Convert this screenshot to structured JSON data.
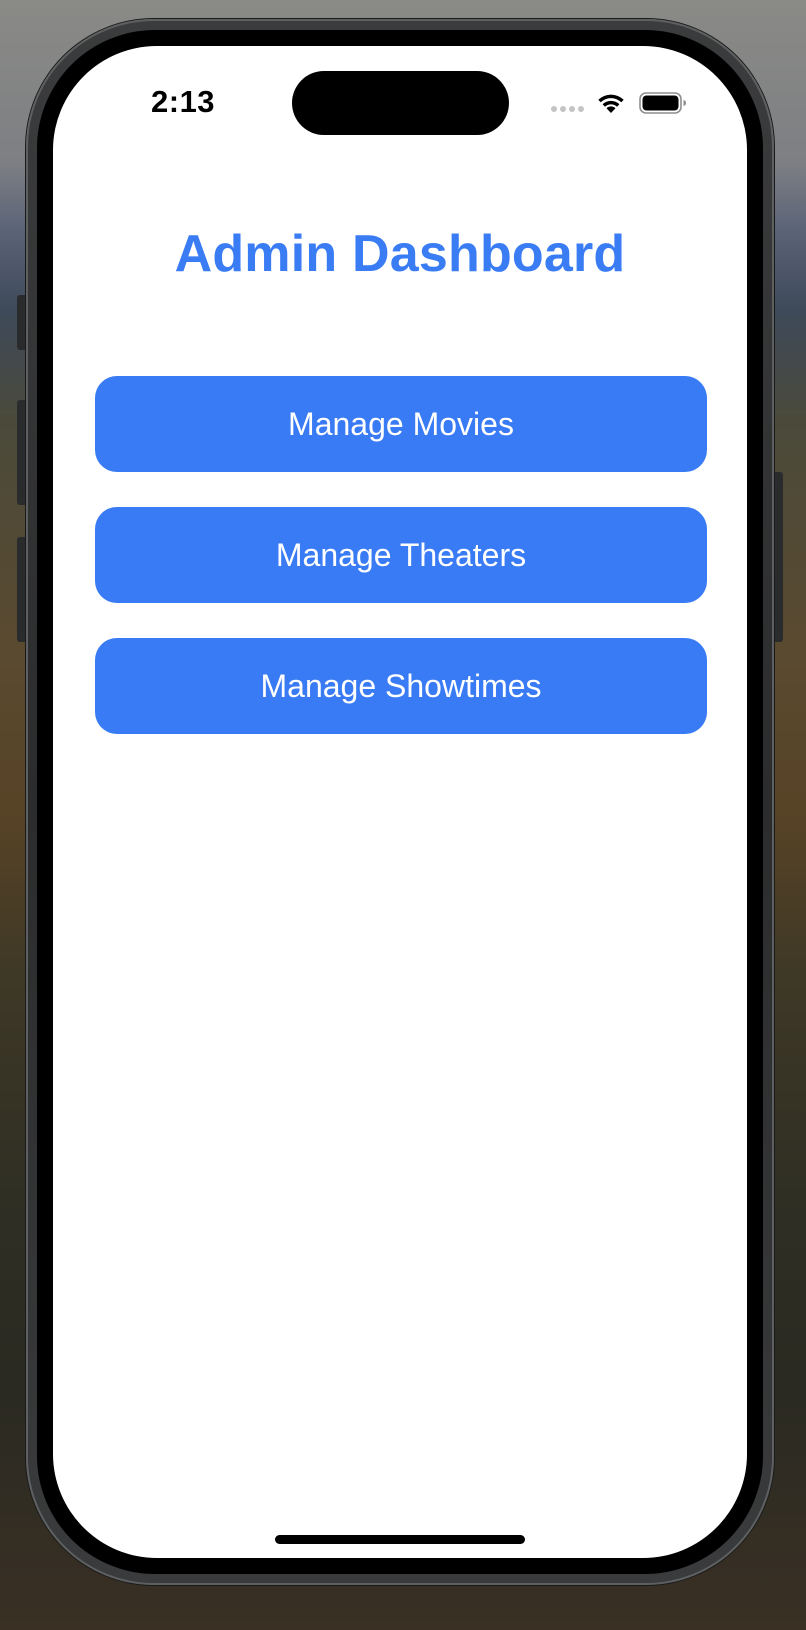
{
  "status_bar": {
    "time": "2:13"
  },
  "screen": {
    "title": "Admin Dashboard",
    "buttons": [
      {
        "label": "Manage Movies"
      },
      {
        "label": "Manage Theaters"
      },
      {
        "label": "Manage Showtimes"
      }
    ]
  },
  "icons": {
    "wifi": "wifi-icon",
    "battery": "battery-icon",
    "signal": "cellular-signal-icon"
  },
  "colors": {
    "accent": "#397bf4",
    "title": "#3a7cf4",
    "background": "#ffffff"
  }
}
